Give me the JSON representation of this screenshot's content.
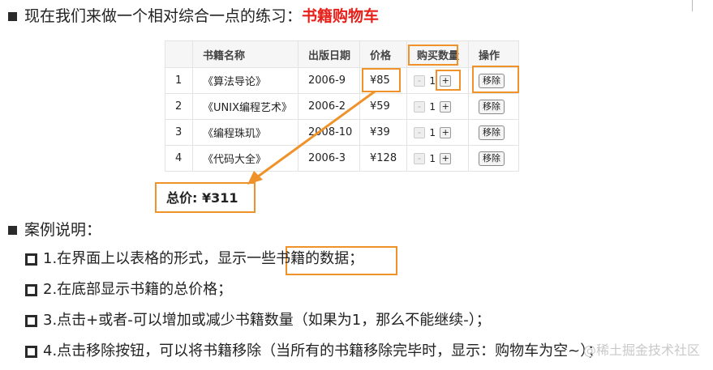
{
  "title": {
    "prefix": "现在我们来做一个相对综合一点的练习：",
    "highlight": "书籍购物车"
  },
  "table": {
    "headers": [
      "",
      "书籍名称",
      "出版日期",
      "价格",
      "购买数量",
      "操作"
    ],
    "rows": [
      {
        "index": "1",
        "name": "《算法导论》",
        "date": "2006-9",
        "price": "¥85",
        "qty": "1"
      },
      {
        "index": "2",
        "name": "《UNIX编程艺术》",
        "date": "2006-2",
        "price": "¥59",
        "qty": "1"
      },
      {
        "index": "3",
        "name": "《编程珠玑》",
        "date": "2008-10",
        "price": "¥39",
        "qty": "1"
      },
      {
        "index": "4",
        "name": "《代码大全》",
        "date": "2006-3",
        "price": "¥128",
        "qty": "1"
      }
    ],
    "minus_label": "-",
    "plus_label": "+",
    "remove_label": "移除"
  },
  "total": "总价: ¥311",
  "case": {
    "title": "案例说明：",
    "items": [
      "1.在界面上以表格的形式，显示一些书籍的数据；",
      "2.在底部显示书籍的总价格；",
      "3.点击+或者-可以增加或减少书籍数量（如果为1，那么不能继续-）；",
      "4.点击移除按钮，可以将书籍移除（当所有的书籍移除完毕时，显示：购物车为空~）；"
    ]
  },
  "watermark": "@稀土掘金技术社区",
  "colors": {
    "highlight": "#e8201a",
    "annotation": "#f0922a"
  }
}
